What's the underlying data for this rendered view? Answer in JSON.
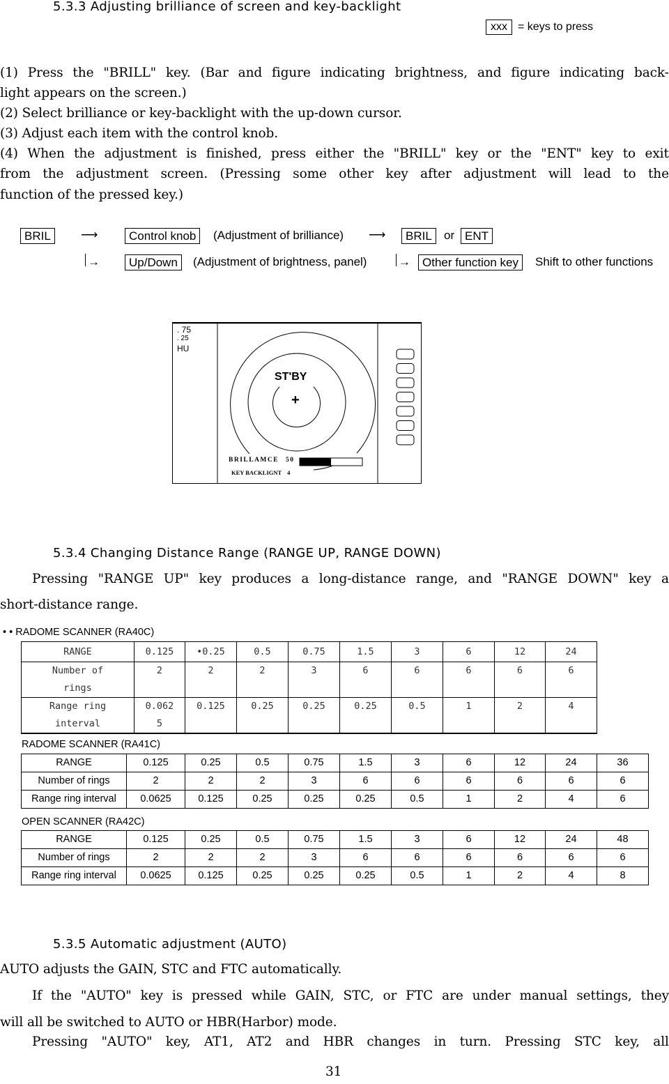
{
  "section_533": {
    "heading": "5.3.3 Adjusting brilliance of screen and key-backlight",
    "legend_key": "xxx",
    "legend_text": "= keys to press",
    "steps": [
      [
        "(1)",
        "Press",
        "the",
        "\"BRILL\"",
        "key.",
        "(Bar",
        "and",
        "figure",
        "indicating",
        "brightness,",
        "and",
        "figure",
        "indicating",
        "back-"
      ],
      "light  appears on the screen.)",
      "(2)  Select brilliance or key-backlight with the up-down cursor.",
      "(3)   Adjust each item with the control knob.",
      [
        "(4)",
        "When",
        "the",
        "adjustment",
        "is",
        "finished,",
        "press",
        "either",
        "the",
        "\"BRILL\"",
        "key",
        "or",
        "the",
        "\"ENT\"",
        "key",
        "to",
        "exit"
      ],
      [
        "from",
        "the",
        "adjustment",
        "screen.",
        "(Pressing",
        "some",
        "other",
        "key",
        "after",
        "adjustment",
        "will",
        "lead",
        "to",
        "the"
      ],
      "function of the pressed key.)"
    ],
    "flow": {
      "row1": {
        "start_key": "BRIL",
        "arrow": "⟶",
        "knob_key": "Control knob",
        "knob_desc": "(Adjustment of brilliance)",
        "arrow2": "⟶",
        "exit_key1": "BRIL",
        "or": "or",
        "exit_key2": "ENT"
      },
      "row2": {
        "branch_arrow": "→",
        "updown_key": "Up/Down",
        "updown_desc": "(Adjustment of brightness, panel)",
        "branch_arrow2": "→",
        "other_key": "Other function key",
        "other_desc": "Shift to other functions"
      }
    },
    "radar_screen": {
      "range_top": ". 75",
      "range_ring": ". 25",
      "orientation": "HU",
      "status": "ST'BY",
      "center_mark": "+",
      "brilliance_label": "BRILLAMCE",
      "brilliance_value": "50",
      "brilliance_fraction": 0.5,
      "backlight_label": "KEY BACKLIGNT",
      "backlight_value": "4",
      "soft_keys_count": 7
    }
  },
  "section_534": {
    "heading": "5.3.4 Changing Distance Range (RANGE UP, RANGE DOWN)",
    "para_line1": [
      "Pressing",
      "\"RANGE",
      "UP\"",
      "key",
      "produces",
      "a",
      "long-distance",
      "range,",
      "and",
      "\"RANGE",
      "DOWN\"",
      "key",
      "a"
    ],
    "para_line2": "short-distance range.",
    "tables": [
      {
        "caption": "• • RADOME SCANNER (RA40C)",
        "rows": [
          [
            "RANGE",
            "0.125",
            "•0.25",
            "0.5",
            "0.75",
            "1.5",
            "3",
            "6",
            "12",
            "24"
          ],
          [
            "Number of rings",
            "2",
            "2",
            "2",
            "3",
            "6",
            "6",
            "6",
            "6",
            "6"
          ],
          [
            "Range ring interval",
            "0.0625",
            "0.125",
            "0.25",
            "0.25",
            "0.25",
            "0.5",
            "1",
            "2",
            "4"
          ]
        ]
      },
      {
        "caption": "RADOME SCANNER (RA41C)",
        "rows": [
          [
            "RANGE",
            "0.125",
            "0.25",
            "0.5",
            "0.75",
            "1.5",
            "3",
            "6",
            "12",
            "24",
            "36"
          ],
          [
            "Number of rings",
            "2",
            "2",
            "2",
            "3",
            "6",
            "6",
            "6",
            "6",
            "6",
            "6"
          ],
          [
            "Range ring interval",
            "0.0625",
            "0.125",
            "0.25",
            "0.25",
            "0.25",
            "0.5",
            "1",
            "2",
            "4",
            "6"
          ]
        ]
      },
      {
        "caption": "OPEN SCANNER (RA42C)",
        "rows": [
          [
            "RANGE",
            "0.125",
            "0.25",
            "0.5",
            "0.75",
            "1.5",
            "3",
            "6",
            "12",
            "24",
            "48"
          ],
          [
            "Number of rings",
            "2",
            "2",
            "2",
            "3",
            "6",
            "6",
            "6",
            "6",
            "6",
            "6"
          ],
          [
            "Range ring interval",
            "0.0625",
            "0.125",
            "0.25",
            "0.25",
            "0.25",
            "0.5",
            "1",
            "2",
            "4",
            "8"
          ]
        ]
      }
    ]
  },
  "section_535": {
    "heading": "5.3.5 Automatic adjustment (AUTO)",
    "line1": " AUTO adjusts the GAIN, STC and FTC automatically.",
    "line2": [
      "If",
      "the",
      "\"AUTO\"",
      "key",
      "is",
      "pressed",
      "while",
      "GAIN,",
      "STC,",
      "or",
      "FTC",
      "are",
      "under",
      "manual",
      "settings,",
      "they"
    ],
    "line3": "will all be switched to AUTO or HBR(Harbor) mode.",
    "line4": [
      "Pressing",
      "\"AUTO\"",
      "key,",
      "AT1,",
      "AT2",
      "and",
      "HBR",
      "changes",
      "in",
      "turn.",
      "Pressing",
      "STC",
      "key,",
      "all"
    ]
  },
  "page_number": "31"
}
